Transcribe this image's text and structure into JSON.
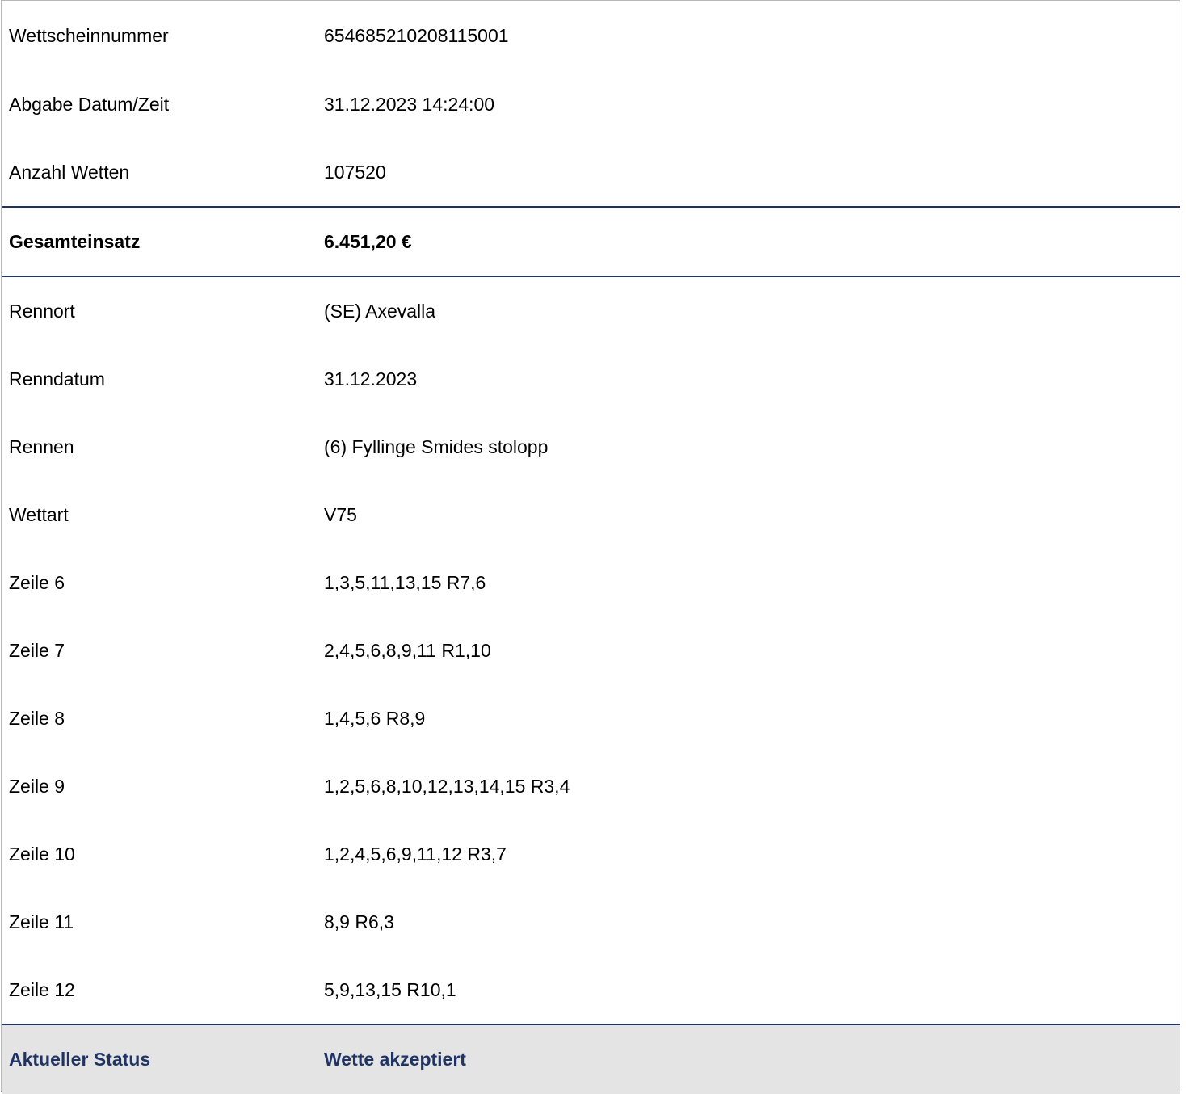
{
  "ticket": {
    "header_rows": [
      {
        "label": "Wettscheinnummer",
        "value": "654685210208115001"
      },
      {
        "label": "Abgabe Datum/Zeit",
        "value": "31.12.2023 14:24:00"
      },
      {
        "label": "Anzahl Wetten",
        "value": "107520"
      }
    ],
    "total": {
      "label": "Gesamteinsatz",
      "value": "6.451,20 €"
    },
    "detail_rows": [
      {
        "label": "Rennort",
        "value": "(SE) Axevalla"
      },
      {
        "label": "Renndatum",
        "value": "31.12.2023"
      },
      {
        "label": "Rennen",
        "value": "(6) Fyllinge Smides stolopp"
      },
      {
        "label": "Wettart",
        "value": "V75"
      },
      {
        "label": "Zeile 6",
        "value": "1,3,5,11,13,15 R7,6"
      },
      {
        "label": "Zeile 7",
        "value": "2,4,5,6,8,9,11 R1,10"
      },
      {
        "label": "Zeile 8",
        "value": "1,4,5,6 R8,9"
      },
      {
        "label": "Zeile 9",
        "value": "1,2,5,6,8,10,12,13,14,15 R3,4"
      },
      {
        "label": "Zeile 10",
        "value": "1,2,4,5,6,9,11,12 R3,7"
      },
      {
        "label": "Zeile 11",
        "value": "8,9 R6,3"
      },
      {
        "label": "Zeile 12",
        "value": "5,9,13,15 R10,1"
      }
    ],
    "status": {
      "label": "Aktueller Status",
      "value": "Wette akzeptiert"
    }
  },
  "colors": {
    "accent": "#1f3464",
    "status_background": "#e4e4e4",
    "outer_border": "#b9b9b9"
  }
}
